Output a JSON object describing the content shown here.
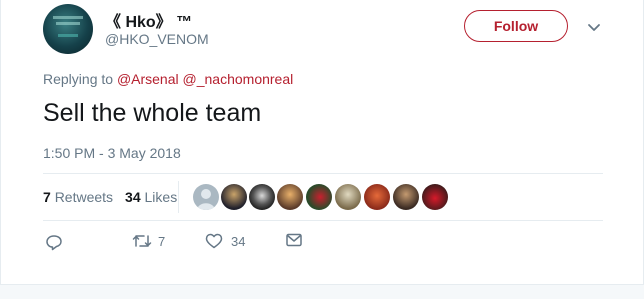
{
  "author": {
    "display_name": "《 Hko》 ™",
    "handle": "@HKO_VENOM"
  },
  "follow_label": "Follow",
  "reply": {
    "prefix": "Replying to ",
    "mentions": [
      "@Arsenal",
      "@_nachomonreal"
    ]
  },
  "tweet_text": "Sell the whole team",
  "timestamp": "1:50 PM - 3 May 2018",
  "stats": {
    "retweets_count": "7",
    "retweets_label": "Retweets",
    "likes_count": "34",
    "likes_label": "Likes"
  },
  "actions": {
    "retweet_count": "7",
    "like_count": "34"
  },
  "colors": {
    "accent": "#b5202f",
    "secondary_text": "#657786",
    "divider": "#e6ecf0"
  },
  "icons": [
    "chevron-down-icon",
    "reply-icon",
    "retweet-icon",
    "like-icon",
    "message-icon"
  ]
}
